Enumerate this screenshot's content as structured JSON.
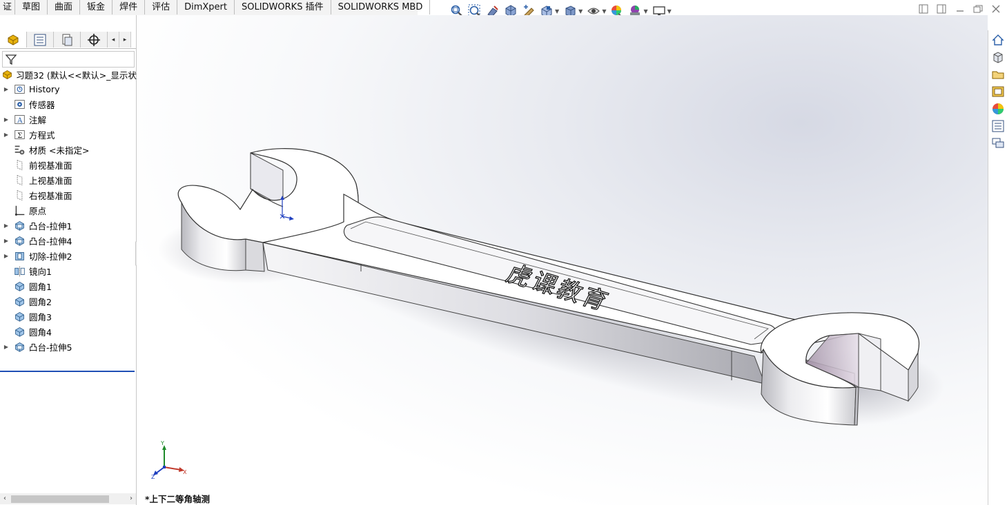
{
  "command_tabs": [
    "证",
    "草图",
    "曲面",
    "钣金",
    "焊件",
    "评估",
    "DimXpert",
    "SOLIDWORKS 插件",
    "SOLIDWORKS MBD"
  ],
  "hud_icons": [
    "zoom-to-fit-icon",
    "zoom-to-area-icon",
    "previous-view-icon",
    "section-view-icon",
    "dynamic-annotation-icon",
    "view-orientation-icon",
    "display-style-icon",
    "hide-show-items-icon",
    "edit-appearance-icon",
    "apply-scene-icon",
    "view-settings-icon"
  ],
  "feature_tree": {
    "root_label": "习题32 (默认<<默认>_显示状态",
    "items": [
      {
        "label": "History",
        "icon": "history-icon",
        "expandable": true
      },
      {
        "label": "传感器",
        "icon": "sensor-icon",
        "expandable": false
      },
      {
        "label": "注解",
        "icon": "annotation-icon",
        "expandable": true
      },
      {
        "label": "方程式",
        "icon": "equation-icon",
        "expandable": true
      },
      {
        "label": "材质 <未指定>",
        "icon": "material-icon",
        "expandable": false
      },
      {
        "label": "前视基准面",
        "icon": "plane-icon",
        "expandable": false
      },
      {
        "label": "上视基准面",
        "icon": "plane-icon",
        "expandable": false
      },
      {
        "label": "右视基准面",
        "icon": "plane-icon",
        "expandable": false
      },
      {
        "label": "原点",
        "icon": "origin-icon",
        "expandable": false
      },
      {
        "label": "凸台-拉伸1",
        "icon": "boss-extrude-icon",
        "expandable": true
      },
      {
        "label": "凸台-拉伸4",
        "icon": "boss-extrude-icon",
        "expandable": true
      },
      {
        "label": "切除-拉伸2",
        "icon": "cut-extrude-icon",
        "expandable": true
      },
      {
        "label": "镜向1",
        "icon": "mirror-icon",
        "expandable": false
      },
      {
        "label": "圆角1",
        "icon": "fillet-icon",
        "expandable": false
      },
      {
        "label": "圆角2",
        "icon": "fillet-icon",
        "expandable": false
      },
      {
        "label": "圆角3",
        "icon": "fillet-icon",
        "expandable": false
      },
      {
        "label": "圆角4",
        "icon": "fillet-icon",
        "expandable": false
      },
      {
        "label": "凸台-拉伸5",
        "icon": "boss-extrude-icon",
        "expandable": true
      }
    ]
  },
  "viewport": {
    "engraved_text": "虎课教育",
    "view_label": "*上下二等角轴测",
    "triad": {
      "x": "X",
      "y": "Y",
      "z": "Z"
    }
  },
  "taskpane_icons": [
    "home-icon",
    "design-library-icon",
    "file-explorer-icon",
    "view-palette-icon",
    "appearances-icon",
    "custom-properties-icon",
    "forum-icon"
  ],
  "colors": {
    "accent": "#1f4fb5",
    "part_yellow": "#e8b30c"
  }
}
